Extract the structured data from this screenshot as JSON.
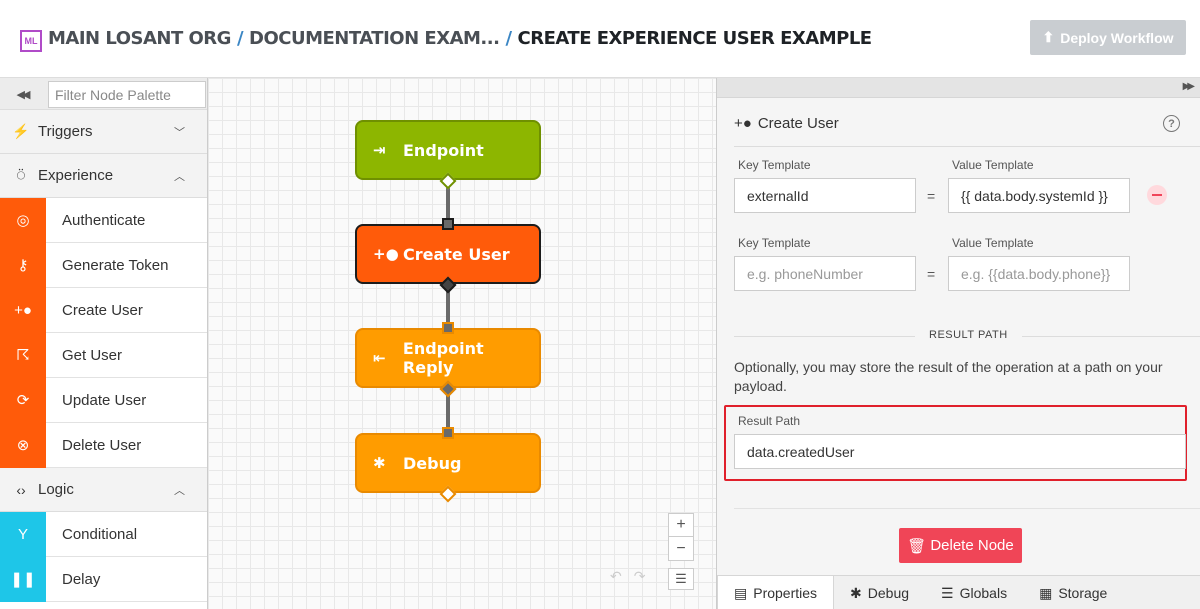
{
  "header": {
    "logo_text": "ML",
    "breadcrumb": [
      "MAIN LOSANT ORG",
      "DOCUMENTATION EXAM...",
      "CREATE EXPERIENCE USER EXAMPLE"
    ],
    "separator": "/",
    "deploy_label": "Deploy Workflow"
  },
  "palette": {
    "filter_placeholder": "Filter Node Palette",
    "categories": [
      {
        "label": "Triggers",
        "icon": "bolt-icon",
        "expanded": false
      },
      {
        "label": "Experience",
        "icon": "drop-icon",
        "expanded": true
      },
      {
        "label": "Logic",
        "icon": "code-icon",
        "expanded": true
      }
    ],
    "experience_nodes": [
      {
        "label": "Authenticate",
        "icon": "fingerprint-icon"
      },
      {
        "label": "Generate Token",
        "icon": "key-icon"
      },
      {
        "label": "Create User",
        "icon": "user-plus-icon"
      },
      {
        "label": "Get User",
        "icon": "walking-user-icon"
      },
      {
        "label": "Update User",
        "icon": "refresh-icon"
      },
      {
        "label": "Delete User",
        "icon": "circle-x-icon"
      }
    ],
    "logic_nodes": [
      {
        "label": "Conditional",
        "icon": "branch-icon"
      },
      {
        "label": "Delay",
        "icon": "pause-icon"
      }
    ],
    "colors": {
      "experience": "#ff5b0a",
      "logic": "#1ec6e8"
    }
  },
  "canvas": {
    "nodes": [
      {
        "label": "Endpoint",
        "color": "#8db600"
      },
      {
        "label": "Create User",
        "color": "#ff5b0a",
        "selected": true
      },
      {
        "label": "Endpoint Reply",
        "color": "#ff9c00"
      },
      {
        "label": "Debug",
        "color": "#ff9c00"
      }
    ],
    "zoom_in": "+",
    "zoom_out": "−"
  },
  "panel": {
    "title": "Create User",
    "rows": [
      {
        "key_label": "Key Template",
        "value_label": "Value Template",
        "key": "externalId",
        "value": "{{ data.body.systemId }}"
      },
      {
        "key_label": "Key Template",
        "value_label": "Value Template",
        "key_placeholder": "e.g. phoneNumber",
        "value_placeholder": "e.g. {{data.body.phone}}"
      }
    ],
    "equals": "=",
    "result_section_title": "RESULT PATH",
    "result_help": "Optionally, you may store the result of the operation at a path on your payload.",
    "result_path_label": "Result Path",
    "result_path_value": "data.createdUser",
    "delete_label": "Delete Node",
    "tabs": [
      {
        "label": "Properties",
        "icon": "document-icon",
        "active": true
      },
      {
        "label": "Debug",
        "icon": "bug-icon"
      },
      {
        "label": "Globals",
        "icon": "list-icon"
      },
      {
        "label": "Storage",
        "icon": "storage-icon"
      }
    ]
  }
}
